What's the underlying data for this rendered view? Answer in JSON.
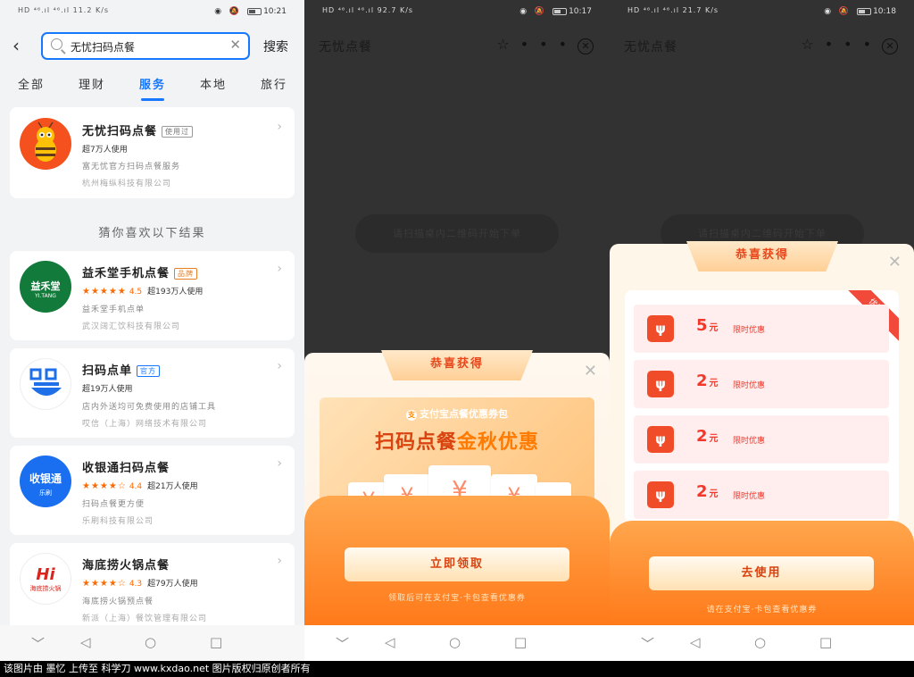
{
  "panel1": {
    "status": {
      "left": "HD ⁴⁶.ıl ⁴⁶.ıl 11.2 K/s",
      "right": "10:21",
      "battery": "57"
    },
    "search": {
      "value": "无忧扫码点餐",
      "button": "搜索"
    },
    "tabs": [
      "全部",
      "理财",
      "服务",
      "本地",
      "旅行"
    ],
    "top_result": {
      "name": "无忧扫码点餐",
      "badge": "使用过",
      "users": "超7万人使用",
      "desc": "富无忧官方扫码点餐服务",
      "company": "杭州梅纵科技有限公司"
    },
    "guess_title": "猜你喜欢以下结果",
    "results": [
      {
        "name": "益禾堂手机点餐",
        "badge": "品牌",
        "rating": "4.5",
        "users": "超193万人使用",
        "desc": "益禾堂手机点单",
        "company": "武汉阔汇饮科技有限公司",
        "logo_text": "益禾堂",
        "logo_sub": "YI.TANG"
      },
      {
        "name": "扫码点单",
        "badge": "官方",
        "rating": "",
        "users": "超19万人使用",
        "desc": "店内外送均可免费使用的店铺工具",
        "company": "哎信（上海）网络技术有限公司",
        "logo_text": "",
        "logo_sub": ""
      },
      {
        "name": "收银通扫码点餐",
        "badge": "",
        "rating": "4.4",
        "users": "超21万人使用",
        "desc": "扫码点餐更方便",
        "company": "乐刷科技有限公司",
        "logo_text": "收银通",
        "logo_sub": "乐刷"
      },
      {
        "name": "海底捞火锅点餐",
        "badge": "",
        "rating": "4.3",
        "users": "超79万人使用",
        "desc": "海底捞火锅预点餐",
        "company": "新派（上海）餐饮管理有限公司",
        "logo_text": "Hi",
        "logo_sub": "海底捞火锅"
      }
    ]
  },
  "panel2": {
    "status": {
      "left": "HD ⁴⁶.ıl ⁴⁶.ıl 92.7 K/s",
      "right": "10:17",
      "battery": "56"
    },
    "title": "无忧点餐",
    "pill": "请扫描桌内二维码开始下单",
    "popup": {
      "ribbon": "恭喜获得",
      "brand": "支付宝点餐优惠券包",
      "headline_a": "扫码点餐",
      "headline_b": "金秋优惠",
      "coupon_symbol": "¥",
      "button": "立即领取",
      "hint": "领取后可在支付宝·卡包查看优惠券"
    }
  },
  "panel3": {
    "status": {
      "left": "HD ⁴⁶.ıl ⁴⁶.ıl 21.7 K/s",
      "right": "10:18",
      "battery": "56"
    },
    "title": "无忧点餐",
    "pill": "请扫描桌内二维码开始下单",
    "popup": {
      "ribbon": "恭喜获得",
      "corner": "优惠券",
      "coupons": [
        {
          "amount": "5",
          "unit": "元",
          "label": "限时优惠"
        },
        {
          "amount": "2",
          "unit": "元",
          "label": "限时优惠"
        },
        {
          "amount": "2",
          "unit": "元",
          "label": "限时优惠"
        },
        {
          "amount": "2",
          "unit": "元",
          "label": "限时优惠"
        }
      ],
      "button": "去使用",
      "hint": "请在支付宝·卡包查看优惠券"
    }
  },
  "navbar": {
    "back": "◁",
    "home": "○",
    "recent": "□",
    "down": "﹀"
  },
  "footer": "该图片由 墨忆 上传至 科学刀 www.kxdao.net 图片版权归原创者所有",
  "colors": {
    "accent": "#1677ff",
    "orange": "#ff7a1a",
    "red": "#f2372b"
  }
}
